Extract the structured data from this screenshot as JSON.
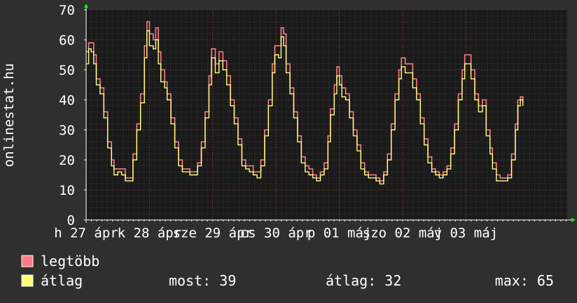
{
  "chart_data": {
    "type": "line",
    "title": "",
    "ylabel": "onlinestat.hu",
    "xlabel": "",
    "ylim": [
      0,
      70
    ],
    "yticks": [
      0,
      10,
      20,
      30,
      40,
      50,
      60,
      70
    ],
    "grid": true,
    "x_range_days": [
      0,
      7.6
    ],
    "x_ticks": [
      {
        "label": "h 27 ápr",
        "day": 0
      },
      {
        "label": "k 28 ápr",
        "day": 1
      },
      {
        "label": "sze 29 ápr",
        "day": 2
      },
      {
        "label": "cs 30 ápr",
        "day": 3
      },
      {
        "label": "p 01 máj",
        "day": 4
      },
      {
        "label": "szo 02 máj",
        "day": 5
      },
      {
        "label": "v 03 máj",
        "day": 6
      }
    ],
    "series": [
      {
        "name": "legtöbb",
        "color": "#ff7b84",
        "points": [
          [
            0.0,
            56
          ],
          [
            0.04,
            59
          ],
          [
            0.08,
            59
          ],
          [
            0.12,
            55
          ],
          [
            0.16,
            47
          ],
          [
            0.22,
            44
          ],
          [
            0.28,
            36
          ],
          [
            0.34,
            26
          ],
          [
            0.4,
            20
          ],
          [
            0.44,
            17
          ],
          [
            0.5,
            17
          ],
          [
            0.56,
            17
          ],
          [
            0.62,
            14
          ],
          [
            0.68,
            14
          ],
          [
            0.74,
            22
          ],
          [
            0.8,
            32
          ],
          [
            0.86,
            42
          ],
          [
            0.92,
            58
          ],
          [
            0.96,
            66
          ],
          [
            1.0,
            62
          ],
          [
            1.06,
            60
          ],
          [
            1.1,
            64
          ],
          [
            1.14,
            56
          ],
          [
            1.18,
            50
          ],
          [
            1.24,
            46
          ],
          [
            1.28,
            42
          ],
          [
            1.34,
            34
          ],
          [
            1.4,
            26
          ],
          [
            1.46,
            20
          ],
          [
            1.52,
            17
          ],
          [
            1.58,
            17
          ],
          [
            1.64,
            16
          ],
          [
            1.7,
            16
          ],
          [
            1.76,
            19
          ],
          [
            1.82,
            26
          ],
          [
            1.88,
            36
          ],
          [
            1.94,
            48
          ],
          [
            1.98,
            57
          ],
          [
            2.04,
            52
          ],
          [
            2.1,
            56
          ],
          [
            2.16,
            53
          ],
          [
            2.22,
            48
          ],
          [
            2.28,
            40
          ],
          [
            2.34,
            34
          ],
          [
            2.4,
            27
          ],
          [
            2.46,
            20
          ],
          [
            2.52,
            18
          ],
          [
            2.58,
            18
          ],
          [
            2.64,
            16
          ],
          [
            2.7,
            16
          ],
          [
            2.76,
            20
          ],
          [
            2.82,
            30
          ],
          [
            2.88,
            40
          ],
          [
            2.94,
            52
          ],
          [
            2.98,
            58
          ],
          [
            3.04,
            58
          ],
          [
            3.08,
            64
          ],
          [
            3.12,
            62
          ],
          [
            3.16,
            52
          ],
          [
            3.22,
            44
          ],
          [
            3.28,
            36
          ],
          [
            3.34,
            28
          ],
          [
            3.4,
            21
          ],
          [
            3.46,
            18
          ],
          [
            3.52,
            17
          ],
          [
            3.58,
            15
          ],
          [
            3.64,
            14
          ],
          [
            3.7,
            16
          ],
          [
            3.76,
            19
          ],
          [
            3.82,
            28
          ],
          [
            3.86,
            37
          ],
          [
            3.92,
            45
          ],
          [
            3.96,
            51
          ],
          [
            4.0,
            48
          ],
          [
            4.04,
            44
          ],
          [
            4.1,
            42
          ],
          [
            4.16,
            36
          ],
          [
            4.22,
            30
          ],
          [
            4.28,
            25
          ],
          [
            4.34,
            19
          ],
          [
            4.4,
            16
          ],
          [
            4.46,
            15
          ],
          [
            4.52,
            15
          ],
          [
            4.58,
            14
          ],
          [
            4.64,
            13
          ],
          [
            4.7,
            16
          ],
          [
            4.76,
            22
          ],
          [
            4.82,
            32
          ],
          [
            4.88,
            42
          ],
          [
            4.94,
            50
          ],
          [
            4.98,
            54
          ],
          [
            5.04,
            52
          ],
          [
            5.1,
            52
          ],
          [
            5.16,
            47
          ],
          [
            5.22,
            42
          ],
          [
            5.28,
            34
          ],
          [
            5.34,
            27
          ],
          [
            5.4,
            21
          ],
          [
            5.46,
            17
          ],
          [
            5.52,
            16
          ],
          [
            5.58,
            15
          ],
          [
            5.64,
            16
          ],
          [
            5.7,
            18
          ],
          [
            5.76,
            24
          ],
          [
            5.82,
            32
          ],
          [
            5.88,
            42
          ],
          [
            5.94,
            50
          ],
          [
            5.98,
            55
          ],
          [
            6.04,
            55
          ],
          [
            6.08,
            50
          ],
          [
            6.14,
            42
          ],
          [
            6.2,
            38
          ],
          [
            6.26,
            40
          ],
          [
            6.32,
            30
          ],
          [
            6.38,
            24
          ],
          [
            6.42,
            19
          ],
          [
            6.48,
            15
          ],
          [
            6.54,
            14
          ],
          [
            6.6,
            14
          ],
          [
            6.66,
            15
          ],
          [
            6.72,
            22
          ],
          [
            6.78,
            32
          ],
          [
            6.82,
            40
          ],
          [
            6.86,
            41
          ],
          [
            6.9,
            39
          ]
        ]
      },
      {
        "name": "átlag",
        "color": "#ffff7b",
        "points": [
          [
            0.0,
            52
          ],
          [
            0.04,
            57
          ],
          [
            0.08,
            56
          ],
          [
            0.12,
            52
          ],
          [
            0.16,
            45
          ],
          [
            0.22,
            42
          ],
          [
            0.28,
            34
          ],
          [
            0.34,
            24
          ],
          [
            0.4,
            18
          ],
          [
            0.44,
            15
          ],
          [
            0.5,
            16
          ],
          [
            0.56,
            15
          ],
          [
            0.62,
            13
          ],
          [
            0.68,
            13
          ],
          [
            0.74,
            20
          ],
          [
            0.8,
            30
          ],
          [
            0.86,
            39
          ],
          [
            0.92,
            54
          ],
          [
            0.96,
            63
          ],
          [
            1.0,
            58
          ],
          [
            1.06,
            57
          ],
          [
            1.1,
            60
          ],
          [
            1.14,
            52
          ],
          [
            1.18,
            46
          ],
          [
            1.24,
            44
          ],
          [
            1.28,
            40
          ],
          [
            1.34,
            32
          ],
          [
            1.4,
            24
          ],
          [
            1.46,
            18
          ],
          [
            1.52,
            16
          ],
          [
            1.58,
            16
          ],
          [
            1.64,
            15
          ],
          [
            1.7,
            15
          ],
          [
            1.76,
            18
          ],
          [
            1.82,
            24
          ],
          [
            1.88,
            34
          ],
          [
            1.94,
            45
          ],
          [
            1.98,
            54
          ],
          [
            2.04,
            49
          ],
          [
            2.1,
            53
          ],
          [
            2.16,
            50
          ],
          [
            2.22,
            45
          ],
          [
            2.28,
            38
          ],
          [
            2.34,
            32
          ],
          [
            2.4,
            25
          ],
          [
            2.46,
            18
          ],
          [
            2.52,
            17
          ],
          [
            2.58,
            16
          ],
          [
            2.64,
            15
          ],
          [
            2.7,
            14
          ],
          [
            2.76,
            18
          ],
          [
            2.82,
            28
          ],
          [
            2.88,
            38
          ],
          [
            2.94,
            49
          ],
          [
            2.98,
            55
          ],
          [
            3.04,
            54
          ],
          [
            3.08,
            61
          ],
          [
            3.12,
            58
          ],
          [
            3.16,
            49
          ],
          [
            3.22,
            42
          ],
          [
            3.28,
            34
          ],
          [
            3.34,
            26
          ],
          [
            3.4,
            19
          ],
          [
            3.46,
            16
          ],
          [
            3.52,
            15
          ],
          [
            3.58,
            14
          ],
          [
            3.64,
            13
          ],
          [
            3.7,
            15
          ],
          [
            3.76,
            17
          ],
          [
            3.82,
            26
          ],
          [
            3.86,
            35
          ],
          [
            3.92,
            42
          ],
          [
            3.96,
            48
          ],
          [
            4.0,
            45
          ],
          [
            4.04,
            41
          ],
          [
            4.1,
            40
          ],
          [
            4.16,
            34
          ],
          [
            4.22,
            28
          ],
          [
            4.28,
            23
          ],
          [
            4.34,
            17
          ],
          [
            4.4,
            15
          ],
          [
            4.46,
            14
          ],
          [
            4.52,
            14
          ],
          [
            4.58,
            13
          ],
          [
            4.64,
            12
          ],
          [
            4.7,
            15
          ],
          [
            4.76,
            20
          ],
          [
            4.82,
            30
          ],
          [
            4.88,
            40
          ],
          [
            4.94,
            47
          ],
          [
            4.98,
            51
          ],
          [
            5.04,
            49
          ],
          [
            5.1,
            49
          ],
          [
            5.16,
            44
          ],
          [
            5.22,
            40
          ],
          [
            5.28,
            32
          ],
          [
            5.34,
            25
          ],
          [
            5.4,
            19
          ],
          [
            5.46,
            16
          ],
          [
            5.52,
            15
          ],
          [
            5.58,
            14
          ],
          [
            5.64,
            15
          ],
          [
            5.7,
            17
          ],
          [
            5.76,
            22
          ],
          [
            5.82,
            30
          ],
          [
            5.88,
            40
          ],
          [
            5.94,
            47
          ],
          [
            5.98,
            52
          ],
          [
            6.04,
            52
          ],
          [
            6.08,
            47
          ],
          [
            6.14,
            40
          ],
          [
            6.2,
            36
          ],
          [
            6.26,
            38
          ],
          [
            6.32,
            28
          ],
          [
            6.38,
            22
          ],
          [
            6.42,
            17
          ],
          [
            6.48,
            13
          ],
          [
            6.54,
            13
          ],
          [
            6.6,
            13
          ],
          [
            6.66,
            14
          ],
          [
            6.72,
            20
          ],
          [
            6.78,
            30
          ],
          [
            6.82,
            38
          ],
          [
            6.86,
            40
          ],
          [
            6.9,
            38
          ]
        ]
      }
    ],
    "legend_placement": "bottom-left",
    "stats": {
      "most_label": "most: 39",
      "atlag_label": "átlag: 32",
      "max_label": "max: 65"
    }
  },
  "colors": {
    "background": "#2f2f2f",
    "plot_background": "#1a1a1a",
    "grid_minor": "#3a3a3a",
    "grid_major": "#6a2a2a",
    "axis": "#ffffff",
    "arrow": "#00ff00"
  }
}
